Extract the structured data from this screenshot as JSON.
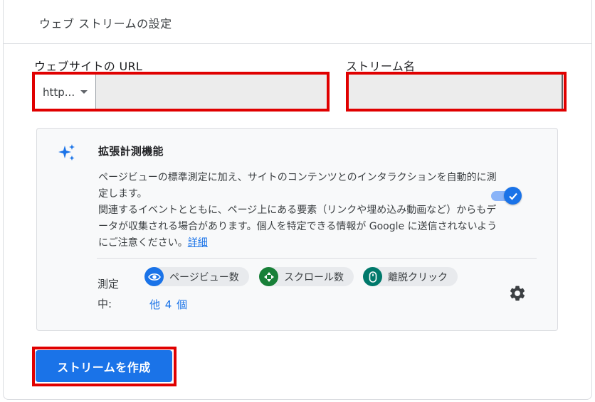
{
  "panel": {
    "title": "ウェブ ストリームの設定"
  },
  "url_field": {
    "label": "ウェブサイトの URL",
    "protocol": "http...",
    "value": "",
    "placeholder": ""
  },
  "name_field": {
    "label": "ストリーム名",
    "value": "",
    "placeholder": ""
  },
  "enhanced_measurement": {
    "title": "拡張計測機能",
    "description_line1": "ページビューの標準測定に加え、サイトのコンテンツとのインタラクションを自動的に測定します。",
    "description_line2": "関連するイベントとともに、ページ上にある要素（リンクや埋め込み動画など）からもデータが収集される場合があります。個人を特定できる情報が Google に送信されないようにご注意ください。",
    "learn_more": "詳細",
    "enabled": true,
    "measuring_label": "測定中:",
    "chips": [
      {
        "label": "ページビュー数",
        "icon": "eye-icon",
        "color": "#1a73e8"
      },
      {
        "label": "スクロール数",
        "icon": "scroll-icon",
        "color": "#188038"
      },
      {
        "label": "離脱クリック",
        "icon": "mouse-icon",
        "color": "#00796b"
      }
    ],
    "more": "他 4 個"
  },
  "actions": {
    "create_label": "ストリームを作成"
  },
  "colors": {
    "accent": "#1a73e8",
    "highlight_border": "#e00000"
  }
}
